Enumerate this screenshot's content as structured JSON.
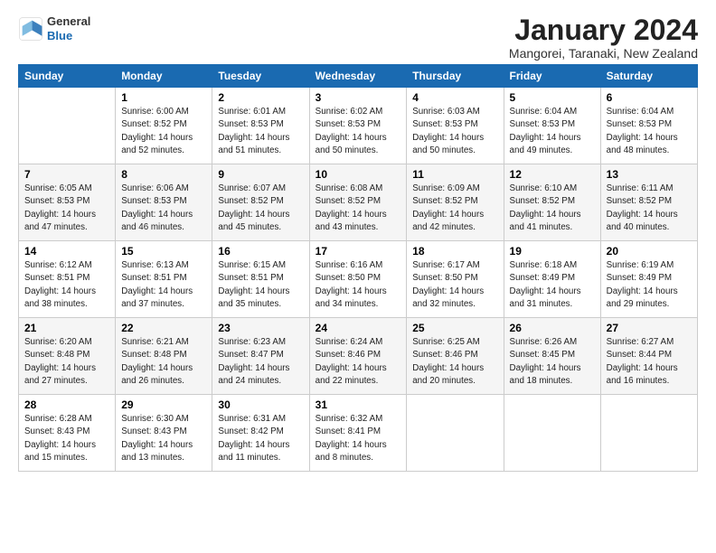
{
  "header": {
    "logo_general": "General",
    "logo_blue": "Blue",
    "title": "January 2024",
    "subtitle": "Mangorei, Taranaki, New Zealand"
  },
  "columns": [
    "Sunday",
    "Monday",
    "Tuesday",
    "Wednesday",
    "Thursday",
    "Friday",
    "Saturday"
  ],
  "weeks": [
    [
      {
        "day": "",
        "info": ""
      },
      {
        "day": "1",
        "info": "Sunrise: 6:00 AM\nSunset: 8:52 PM\nDaylight: 14 hours\nand 52 minutes."
      },
      {
        "day": "2",
        "info": "Sunrise: 6:01 AM\nSunset: 8:53 PM\nDaylight: 14 hours\nand 51 minutes."
      },
      {
        "day": "3",
        "info": "Sunrise: 6:02 AM\nSunset: 8:53 PM\nDaylight: 14 hours\nand 50 minutes."
      },
      {
        "day": "4",
        "info": "Sunrise: 6:03 AM\nSunset: 8:53 PM\nDaylight: 14 hours\nand 50 minutes."
      },
      {
        "day": "5",
        "info": "Sunrise: 6:04 AM\nSunset: 8:53 PM\nDaylight: 14 hours\nand 49 minutes."
      },
      {
        "day": "6",
        "info": "Sunrise: 6:04 AM\nSunset: 8:53 PM\nDaylight: 14 hours\nand 48 minutes."
      }
    ],
    [
      {
        "day": "7",
        "info": "Sunrise: 6:05 AM\nSunset: 8:53 PM\nDaylight: 14 hours\nand 47 minutes."
      },
      {
        "day": "8",
        "info": "Sunrise: 6:06 AM\nSunset: 8:53 PM\nDaylight: 14 hours\nand 46 minutes."
      },
      {
        "day": "9",
        "info": "Sunrise: 6:07 AM\nSunset: 8:52 PM\nDaylight: 14 hours\nand 45 minutes."
      },
      {
        "day": "10",
        "info": "Sunrise: 6:08 AM\nSunset: 8:52 PM\nDaylight: 14 hours\nand 43 minutes."
      },
      {
        "day": "11",
        "info": "Sunrise: 6:09 AM\nSunset: 8:52 PM\nDaylight: 14 hours\nand 42 minutes."
      },
      {
        "day": "12",
        "info": "Sunrise: 6:10 AM\nSunset: 8:52 PM\nDaylight: 14 hours\nand 41 minutes."
      },
      {
        "day": "13",
        "info": "Sunrise: 6:11 AM\nSunset: 8:52 PM\nDaylight: 14 hours\nand 40 minutes."
      }
    ],
    [
      {
        "day": "14",
        "info": "Sunrise: 6:12 AM\nSunset: 8:51 PM\nDaylight: 14 hours\nand 38 minutes."
      },
      {
        "day": "15",
        "info": "Sunrise: 6:13 AM\nSunset: 8:51 PM\nDaylight: 14 hours\nand 37 minutes."
      },
      {
        "day": "16",
        "info": "Sunrise: 6:15 AM\nSunset: 8:51 PM\nDaylight: 14 hours\nand 35 minutes."
      },
      {
        "day": "17",
        "info": "Sunrise: 6:16 AM\nSunset: 8:50 PM\nDaylight: 14 hours\nand 34 minutes."
      },
      {
        "day": "18",
        "info": "Sunrise: 6:17 AM\nSunset: 8:50 PM\nDaylight: 14 hours\nand 32 minutes."
      },
      {
        "day": "19",
        "info": "Sunrise: 6:18 AM\nSunset: 8:49 PM\nDaylight: 14 hours\nand 31 minutes."
      },
      {
        "day": "20",
        "info": "Sunrise: 6:19 AM\nSunset: 8:49 PM\nDaylight: 14 hours\nand 29 minutes."
      }
    ],
    [
      {
        "day": "21",
        "info": "Sunrise: 6:20 AM\nSunset: 8:48 PM\nDaylight: 14 hours\nand 27 minutes."
      },
      {
        "day": "22",
        "info": "Sunrise: 6:21 AM\nSunset: 8:48 PM\nDaylight: 14 hours\nand 26 minutes."
      },
      {
        "day": "23",
        "info": "Sunrise: 6:23 AM\nSunset: 8:47 PM\nDaylight: 14 hours\nand 24 minutes."
      },
      {
        "day": "24",
        "info": "Sunrise: 6:24 AM\nSunset: 8:46 PM\nDaylight: 14 hours\nand 22 minutes."
      },
      {
        "day": "25",
        "info": "Sunrise: 6:25 AM\nSunset: 8:46 PM\nDaylight: 14 hours\nand 20 minutes."
      },
      {
        "day": "26",
        "info": "Sunrise: 6:26 AM\nSunset: 8:45 PM\nDaylight: 14 hours\nand 18 minutes."
      },
      {
        "day": "27",
        "info": "Sunrise: 6:27 AM\nSunset: 8:44 PM\nDaylight: 14 hours\nand 16 minutes."
      }
    ],
    [
      {
        "day": "28",
        "info": "Sunrise: 6:28 AM\nSunset: 8:43 PM\nDaylight: 14 hours\nand 15 minutes."
      },
      {
        "day": "29",
        "info": "Sunrise: 6:30 AM\nSunset: 8:43 PM\nDaylight: 14 hours\nand 13 minutes."
      },
      {
        "day": "30",
        "info": "Sunrise: 6:31 AM\nSunset: 8:42 PM\nDaylight: 14 hours\nand 11 minutes."
      },
      {
        "day": "31",
        "info": "Sunrise: 6:32 AM\nSunset: 8:41 PM\nDaylight: 14 hours\nand 8 minutes."
      },
      {
        "day": "",
        "info": ""
      },
      {
        "day": "",
        "info": ""
      },
      {
        "day": "",
        "info": ""
      }
    ]
  ]
}
